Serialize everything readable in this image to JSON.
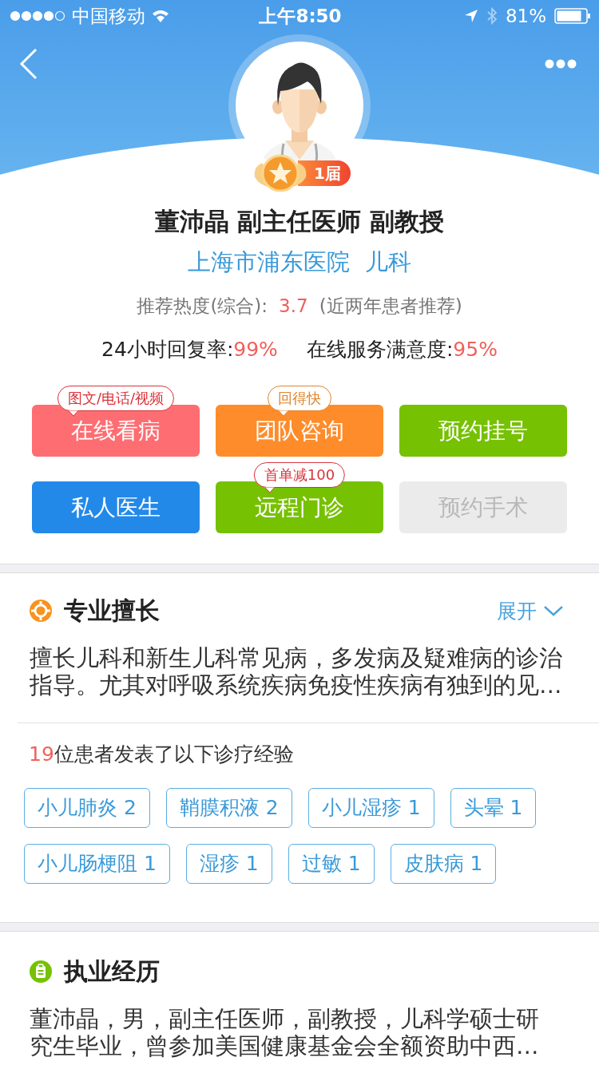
{
  "status_bar": {
    "carrier": "中国移动",
    "time": "上午8:50",
    "battery": "81%"
  },
  "doctor": {
    "badge": "1届",
    "name": "董沛晶 副主任医师 副教授",
    "hospital": "上海市浦东医院  儿科",
    "rating": {
      "label": "推荐热度(综合):",
      "score": "3.7",
      "note": "(近两年患者推荐)"
    },
    "stats": [
      {
        "label": "24小时回复率:",
        "value": "99%"
      },
      {
        "label": "在线服务满意度:",
        "value": "95%"
      }
    ]
  },
  "services": [
    {
      "label": "在线看病",
      "color": "#fe6d71",
      "disabled": false,
      "tag": {
        "text": "图文/电话/视频",
        "color": "#d9333a"
      }
    },
    {
      "label": "团队咨询",
      "color": "#fe8c2a",
      "disabled": false,
      "tag": {
        "text": "回得快",
        "color": "#e0862c"
      }
    },
    {
      "label": "预约挂号",
      "color": "#76c102",
      "disabled": false
    },
    {
      "label": "私人医生",
      "color": "#2389e9",
      "disabled": false
    },
    {
      "label": "远程门诊",
      "color": "#76c102",
      "disabled": false,
      "tag": {
        "text": "首单减100",
        "color": "#d9333a"
      }
    },
    {
      "label": "预约手术",
      "color": "#ebebeb",
      "disabled": true
    }
  ],
  "expertise": {
    "title": "专业擅长",
    "expand": "展开",
    "text": "擅长儿科和新生儿科常见病，多发病及疑难病的诊治指导。尤其对呼吸系统疾病免疫性疾病有独到的见…",
    "experience": {
      "count": "19",
      "text": "位患者发表了以下诊疗经验"
    },
    "tags": [
      "小儿肺炎 2",
      "鞘膜积液 2",
      "小儿湿疹 1",
      "头晕 1",
      "小儿肠梗阻 1",
      "湿疹 1",
      "过敏 1",
      "皮肤病 1"
    ]
  },
  "practice": {
    "title": "执业经历",
    "text": "董沛晶，男，副主任医师，副教授，儿科学硕士研究生毕业，曾参加美国健康基金会全额资助中西…"
  }
}
